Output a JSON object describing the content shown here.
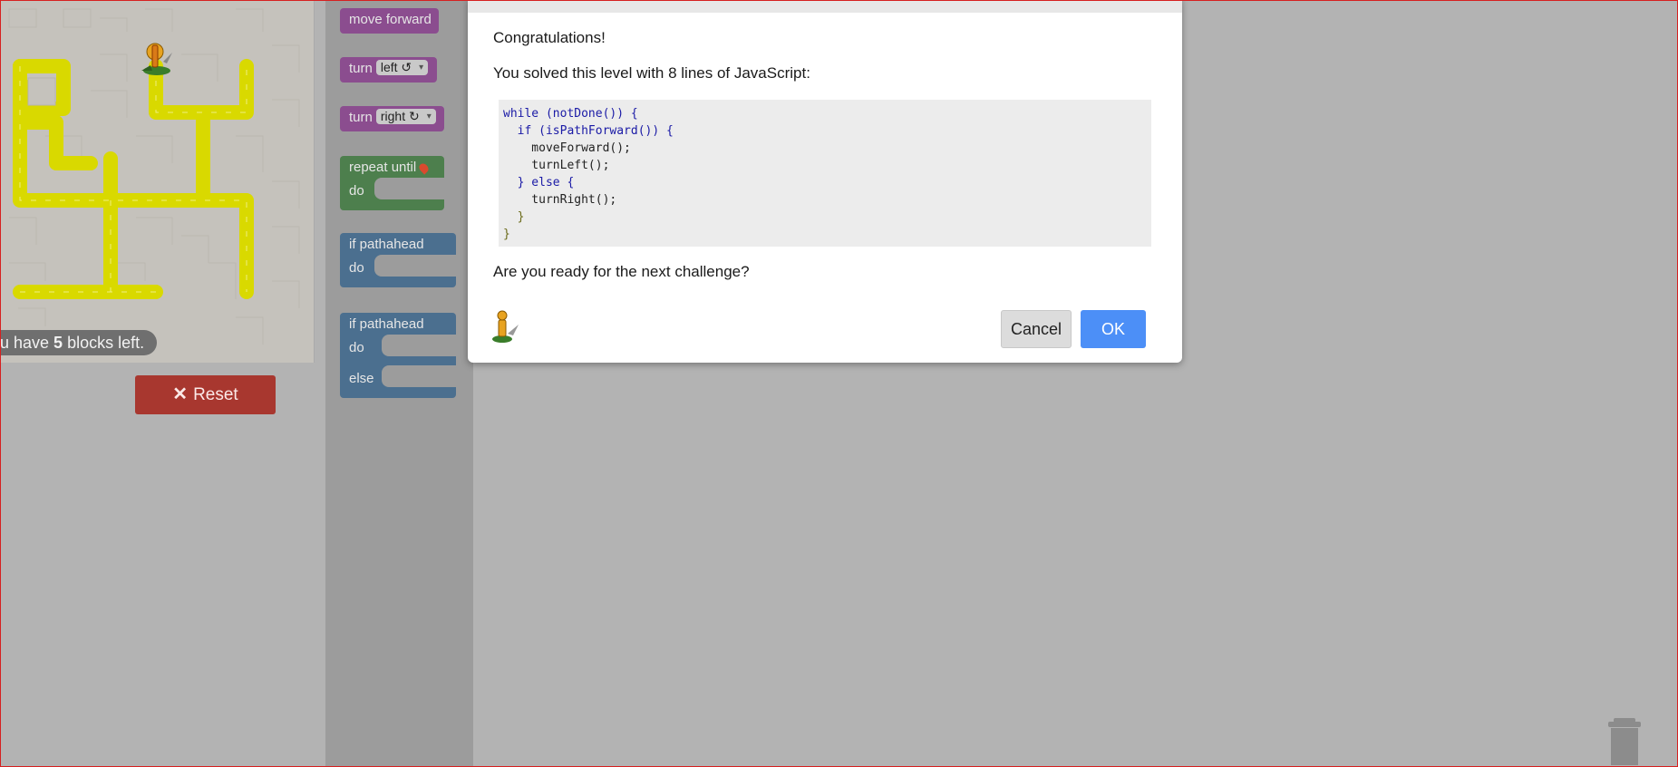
{
  "maze": {
    "blocks_left_prefix": "u have ",
    "blocks_left_count": "5",
    "blocks_left_suffix": " blocks left.",
    "reset_label": "Reset",
    "path_color": "#d9d900",
    "background_color": "#c5c2bc"
  },
  "toolbox": {
    "move_forward": "move forward",
    "turn_label": "turn",
    "turn_left_option": "left ↺",
    "turn_right_option": "right ↻",
    "repeat_until": "repeat until",
    "do_label": "do",
    "if_path": "if path",
    "ahead_option": "ahead",
    "else_label": "else",
    "colors": {
      "movement": "#8b4d8f",
      "loop": "#4d7f4d",
      "logic": "#4b6f8f"
    }
  },
  "dialog": {
    "title": "Congratulations!",
    "message": "You solved this level with 8 lines of JavaScript:",
    "code_lines": [
      "while (notDone()) {",
      "  if (isPathForward()) {",
      "    moveForward();",
      "    turnLeft();",
      "  } else {",
      "    turnRight();",
      "  }",
      "}"
    ],
    "question": "Are you ready for the next challenge?",
    "cancel_label": "Cancel",
    "ok_label": "OK",
    "ok_color": "#4c8ff7"
  },
  "icons": [
    "pegman-icon",
    "marker-icon",
    "close-icon",
    "trash-icon"
  ]
}
